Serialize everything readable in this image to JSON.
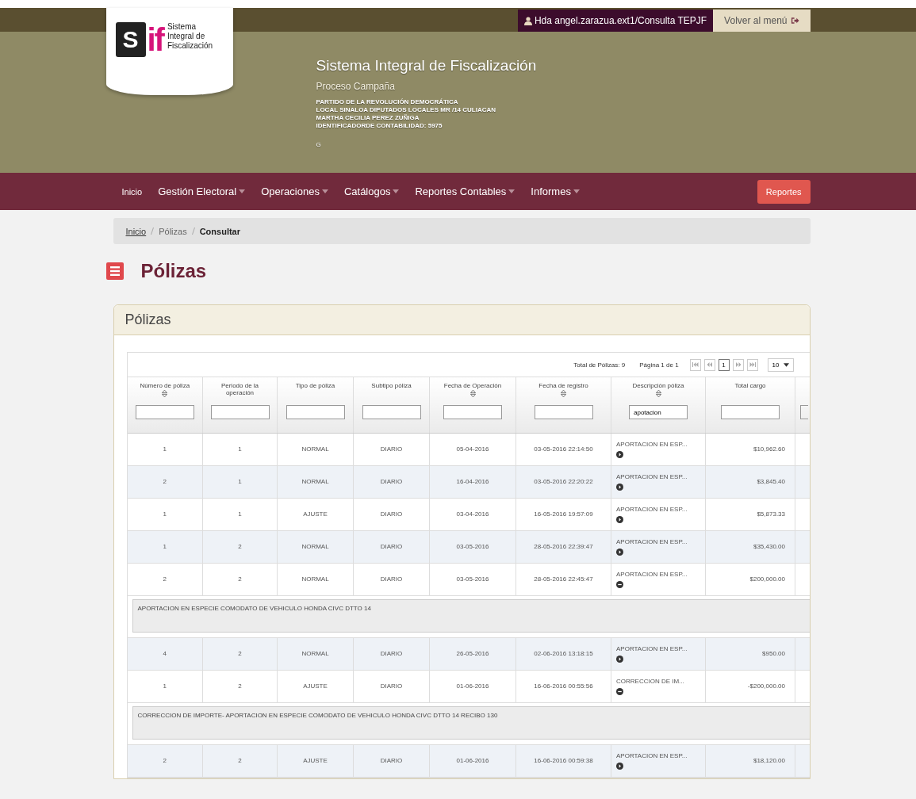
{
  "header": {
    "logo": {
      "box_letter": "S",
      "mark": "if",
      "caption": [
        "Sistema",
        "Integral de",
        "Fiscalización"
      ]
    },
    "user": "Hda angel.zarazua.ext1/Consulta TEPJF",
    "back_button": "Volver al menú",
    "title": "Sistema Integral de Fiscalización",
    "subtitle": "Proceso Campaña",
    "details": [
      "PARTIDO DE LA REVOLUCIÓN DEMOCRÁTICA",
      "LOCAL SINALOA DIPUTADOS LOCALES MR /14 CULIACAN",
      "MARTHA CECILIA PEREZ ZUÑIGA",
      "IDENTIFICADORDE CONTABILIDAD: 5975"
    ],
    "note": "G"
  },
  "nav": {
    "items": [
      {
        "label": "Inicio",
        "dropdown": false
      },
      {
        "label": "Gestión Electoral",
        "dropdown": true
      },
      {
        "label": "Operaciones",
        "dropdown": true
      },
      {
        "label": "Catálogos",
        "dropdown": true
      },
      {
        "label": "Reportes Contables",
        "dropdown": true
      },
      {
        "label": "Informes",
        "dropdown": true
      }
    ],
    "button": "Reportes"
  },
  "breadcrumb": [
    {
      "label": "Inicio",
      "link": true
    },
    {
      "label": "Pólizas",
      "link": false
    },
    {
      "label": "Consultar",
      "link": false
    }
  ],
  "page_title": "Pólizas",
  "panel": {
    "title": "Pólizas",
    "pager": {
      "total": "Total de Pólizas: 9",
      "page": "Página 1 de 1",
      "pages": [
        {
          "label": "1",
          "selected": true
        }
      ],
      "page_size": "10"
    },
    "columns": [
      {
        "label": "Número de póliza",
        "sortable": true
      },
      {
        "label": "Periodo de la operación",
        "sortable": false
      },
      {
        "label": "Tipo de póliza",
        "sortable": false
      },
      {
        "label": "Subtipo póliza",
        "sortable": false
      },
      {
        "label": "Fecha de Operación",
        "sortable": true
      },
      {
        "label": "Fecha de registro",
        "sortable": true
      },
      {
        "label": "Descripción póliza",
        "sortable": true,
        "filter": "apotacion"
      },
      {
        "label": "Total cargo",
        "sortable": false
      }
    ],
    "rows": [
      {
        "cells": [
          "1",
          "1",
          "NORMAL",
          "DIARIO",
          "05-04-2016",
          "03-05-2016 22:14:50"
        ],
        "description": "APORTACION EN ESP...",
        "total": "$10,962.60",
        "expanded": false
      },
      {
        "cells": [
          "2",
          "1",
          "NORMAL",
          "DIARIO",
          "16-04-2016",
          "03-05-2016 22:20:22"
        ],
        "description": "APORTACION EN ESP...",
        "total": "$3,845.40",
        "expanded": false
      },
      {
        "cells": [
          "1",
          "1",
          "AJUSTE",
          "DIARIO",
          "03-04-2016",
          "16-05-2016 19:57:09"
        ],
        "description": "APORTACION EN ESP...",
        "total": "$5,873.33",
        "expanded": false
      },
      {
        "cells": [
          "1",
          "2",
          "NORMAL",
          "DIARIO",
          "03-05-2016",
          "28-05-2016 22:39:47"
        ],
        "description": "APORTACION EN ESP...",
        "total": "$35,430.00",
        "expanded": false
      },
      {
        "cells": [
          "2",
          "2",
          "NORMAL",
          "DIARIO",
          "03-05-2016",
          "28-05-2016 22:45:47"
        ],
        "description": "APORTACION EN ESP...",
        "total": "$200,000.00",
        "expanded": true,
        "detail": "APORTACION EN ESPECIE COMODATO DE VEHICULO HONDA CIVC DTTO 14"
      },
      {
        "cells": [
          "4",
          "2",
          "NORMAL",
          "DIARIO",
          "26-05-2016",
          "02-06-2016 13:18:15"
        ],
        "description": "APORTACION EN ESP...",
        "total": "$950.00",
        "expanded": false
      },
      {
        "cells": [
          "1",
          "2",
          "AJUSTE",
          "DIARIO",
          "01-06-2016",
          "16-06-2016 00:55:56"
        ],
        "description": "CORRECCION DE IM...",
        "total": "-$200,000.00",
        "expanded": true,
        "detail": "CORRECCION DE IMPORTE- APORTACION EN ESPECIE COMODATO DE VEHICULO HONDA CIVC DTTO 14 RECIBO 130"
      },
      {
        "cells": [
          "2",
          "2",
          "AJUSTE",
          "DIARIO",
          "01-06-2016",
          "16-06-2016 00:59:38"
        ],
        "description": "APORTACION EN ESP...",
        "total": "$18,120.00",
        "expanded": false
      }
    ]
  }
}
